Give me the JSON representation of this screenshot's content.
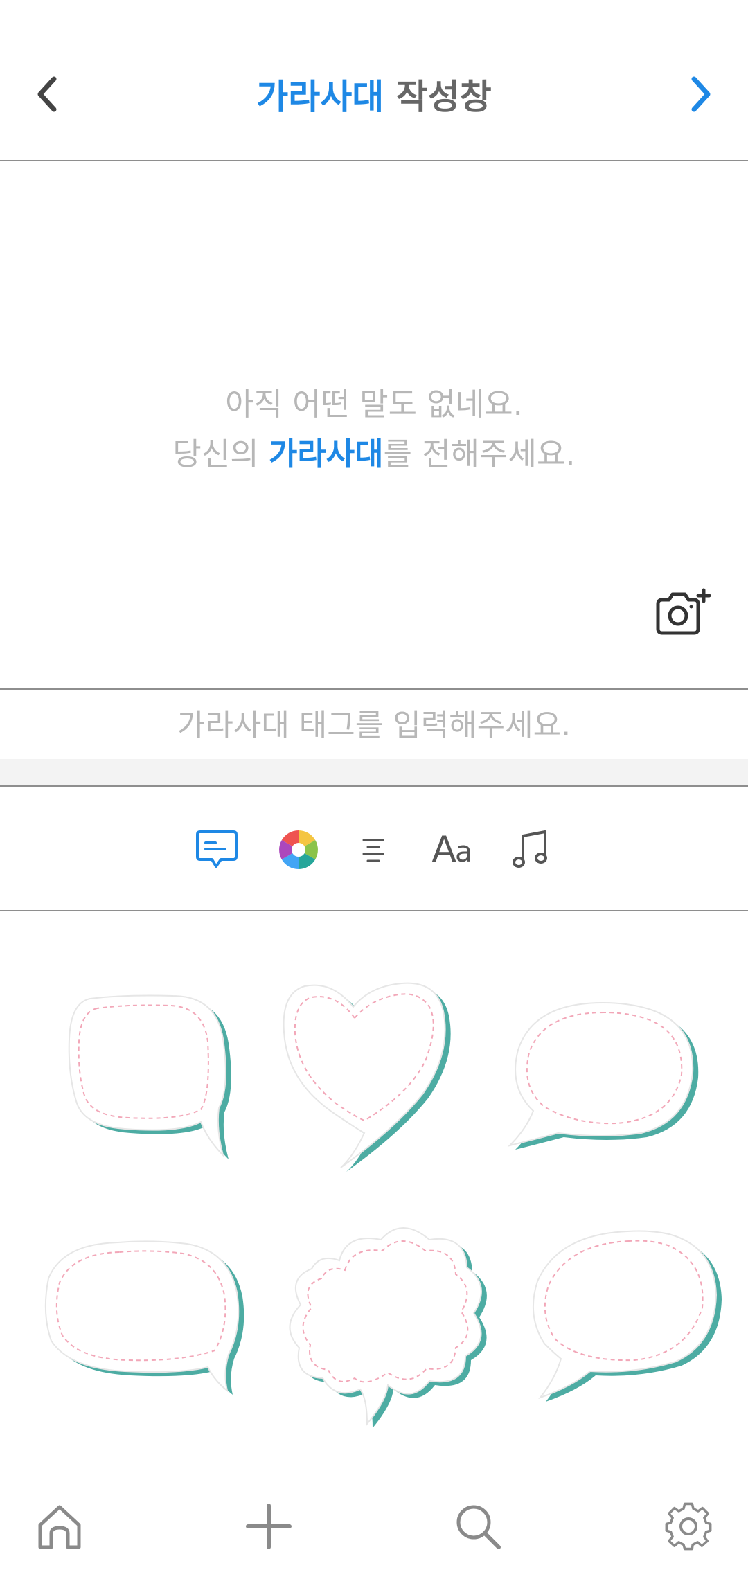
{
  "header": {
    "title_accent": "가라사대",
    "title_rest": " 작성창"
  },
  "canvas": {
    "line1": "아직 어떤 말도 없네요.",
    "line2_prefix": "당신의 ",
    "line2_accent": "가라사대",
    "line2_suffix": "를 전해주세요."
  },
  "tag": {
    "placeholder": "가라사대 태그를 입력해주세요.",
    "value": ""
  },
  "toolbar": {
    "items": [
      {
        "name": "speech-bubble-tool",
        "icon": "speech-bubble-icon",
        "active": true
      },
      {
        "name": "color-tool",
        "icon": "color-wheel-icon"
      },
      {
        "name": "align-tool",
        "icon": "align-center-icon"
      },
      {
        "name": "font-tool",
        "icon": "font-icon",
        "label_big": "A",
        "label_small": "a"
      },
      {
        "name": "music-tool",
        "icon": "music-note-icon"
      }
    ]
  },
  "bubbles": {
    "shapes": [
      "round-bubble-right-tail",
      "heart-bubble",
      "oval-bubble-left-tail",
      "wide-bubble-right-tail",
      "cloud-bubble",
      "oval-bubble-left-tail-2"
    ]
  },
  "nav": {
    "items": [
      "home-icon",
      "plus-icon",
      "search-icon",
      "gear-icon"
    ]
  },
  "colors": {
    "accent": "#1e88e5",
    "bubble_shadow": "#2e9e93",
    "bubble_dash": "#f2a7b8",
    "placeholder": "#b7b7b7"
  }
}
